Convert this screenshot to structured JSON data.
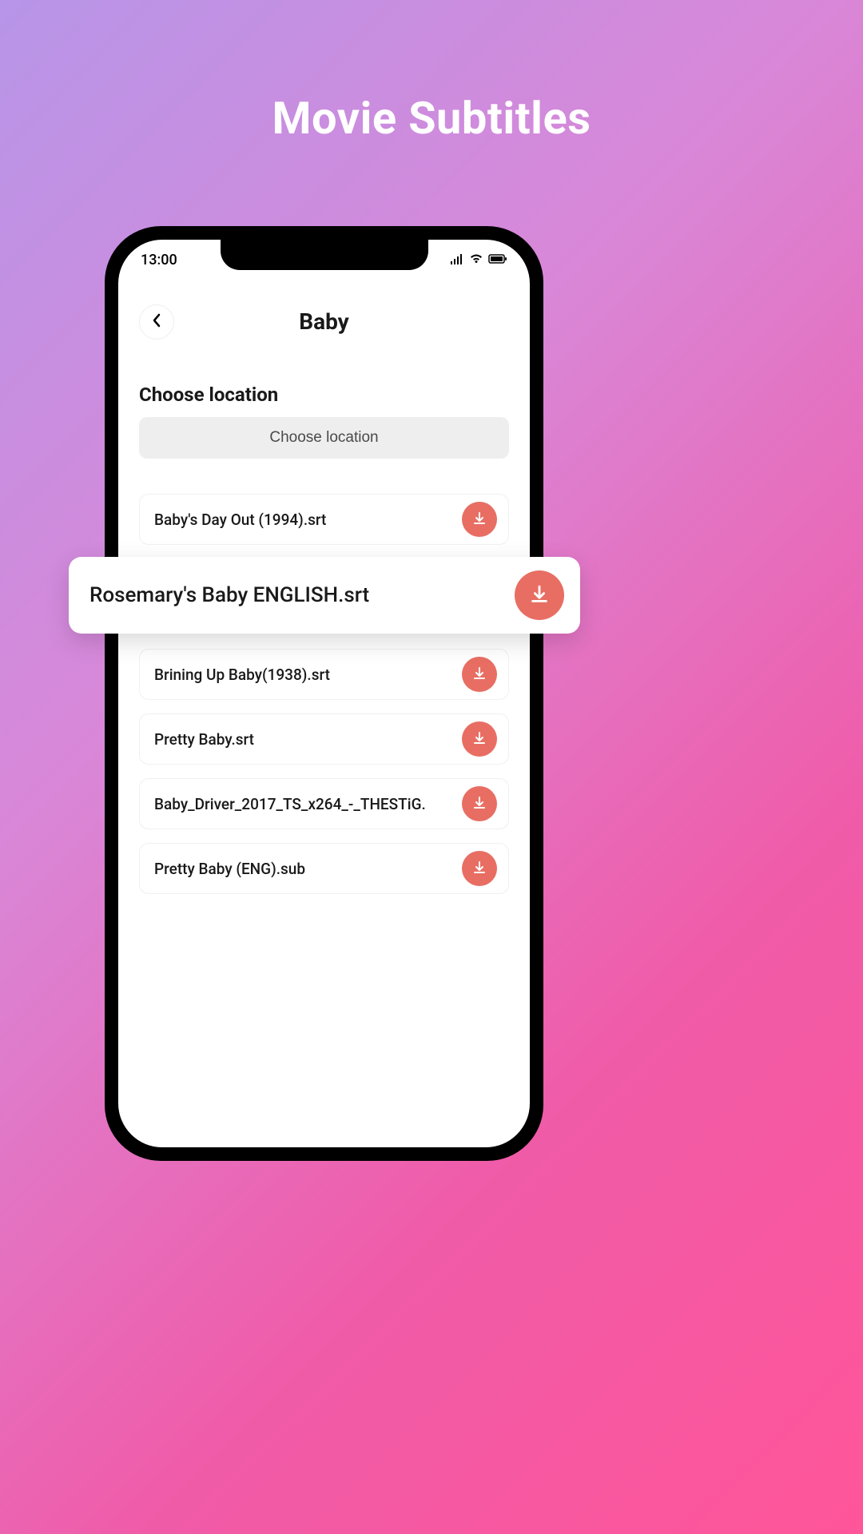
{
  "page": {
    "title": "Movie Subtitles"
  },
  "statusBar": {
    "time": "13:00"
  },
  "header": {
    "title": "Baby"
  },
  "section": {
    "label": "Choose location",
    "buttonLabel": "Choose location"
  },
  "featured": {
    "label": "Rosemary's Baby ENGLISH.srt"
  },
  "items": [
    {
      "label": "Baby's Day Out (1994).srt"
    },
    {
      "label": "Brining Up Baby(1938).srt"
    },
    {
      "label": "Pretty Baby.srt"
    },
    {
      "label": "Baby_Driver_2017_TS_x264_-_THESTiG."
    },
    {
      "label": "Pretty Baby (ENG).sub"
    }
  ],
  "colors": {
    "accent": "#e86e63"
  }
}
